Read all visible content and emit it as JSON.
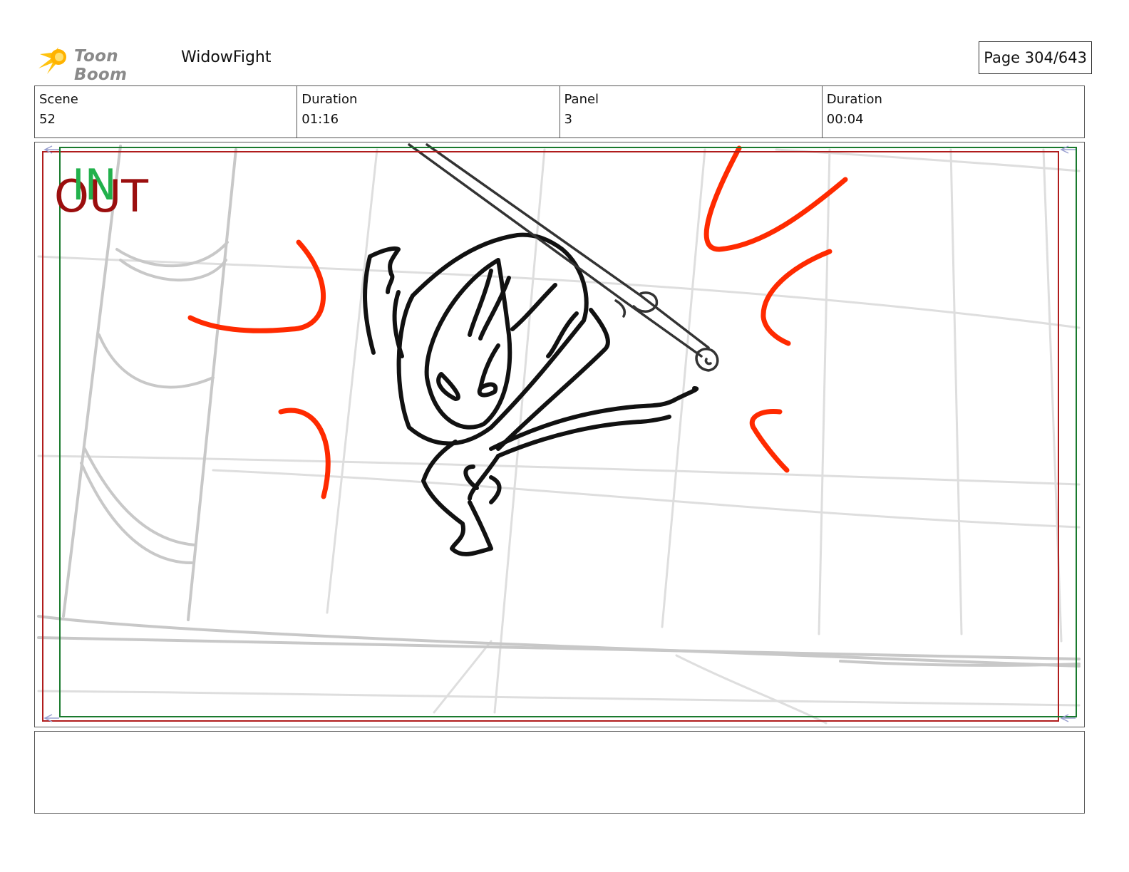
{
  "header": {
    "logo_text": "Toon Boom",
    "project_name": "WidowFight",
    "page_label": "Page 304/643"
  },
  "info": {
    "scene_label": "Scene",
    "scene_value": "52",
    "duration_label": "Duration",
    "duration_value": "01:16",
    "panel_label": "Panel",
    "panel_value": "3",
    "panel_duration_label": "Duration",
    "panel_duration_value": "00:04"
  },
  "frame": {
    "in_marker": "IN",
    "out_marker": "OUT",
    "colors": {
      "in_frame": "#1a7a2e",
      "out_frame": "#b01c1c",
      "action_lines": "#ff2a00",
      "character_ink": "#111111",
      "background_sketch": "#cfcfcf"
    }
  },
  "notes": {
    "text": ""
  },
  "icons": [
    "toon-boom-logo-icon"
  ]
}
